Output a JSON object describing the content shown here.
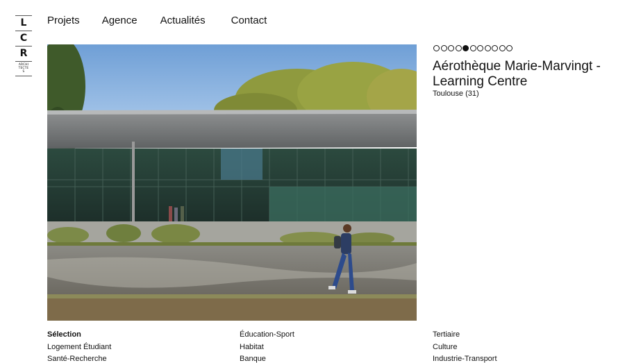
{
  "logo": {
    "letters": [
      "L",
      "C",
      "R"
    ],
    "small_text": [
      "ARCHI",
      "TECTE",
      "S"
    ]
  },
  "nav": {
    "items": [
      "Projets",
      "Agence",
      "Actualités",
      "Contact"
    ]
  },
  "hero": {
    "icon": "building-photo"
  },
  "slider": {
    "total": 11,
    "active_index": 4
  },
  "project": {
    "title": "Aérothèque Marie-Marvingt - Learning Centre",
    "location": "Toulouse (31)"
  },
  "categories": {
    "col1": [
      "Sélection",
      "Logement Étudiant",
      "Santé-Recherche"
    ],
    "col2": [
      "Éducation-Sport",
      "Habitat",
      "Banque"
    ],
    "col3": [
      "Tertiaire",
      "Culture",
      "Industrie-Transport"
    ]
  },
  "colors": {
    "text": "#111111",
    "background": "#ffffff"
  }
}
